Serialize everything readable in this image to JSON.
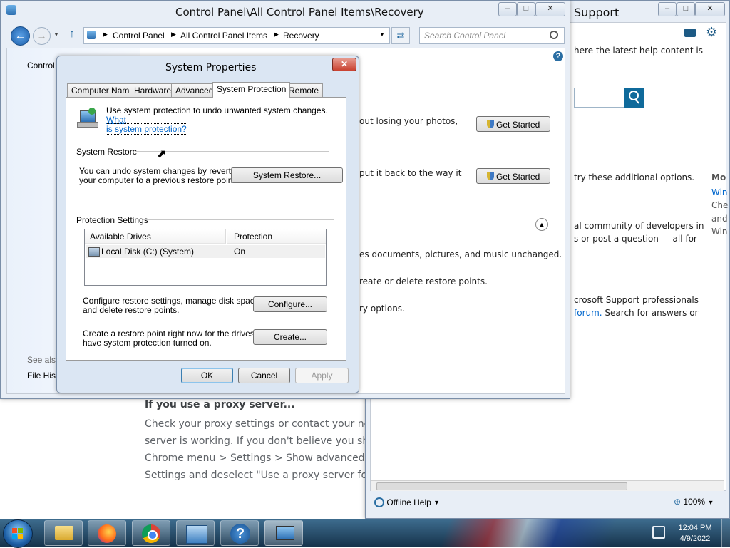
{
  "chrome_page": {
    "heading": "If you use a proxy server...",
    "lines": [
      "Check your proxy settings or contact your netw",
      "server is working. If you don't believe you shou",
      "Chrome menu > Settings > Show advanced se",
      "Settings and deselect \"Use a proxy server for y"
    ]
  },
  "help_window": {
    "title": "Support",
    "intro": "here the latest help content is",
    "options_text": "try these additional options.",
    "community_text_1": "al community of developers in",
    "community_text_2": "s or post a question — all for",
    "support_text_1": "crosoft Support professionals",
    "support_link": "forum.",
    "support_text_2": " Search for answers or",
    "more_heading": "Mo",
    "more_links": [
      "Win",
      "Che",
      "and",
      "Win"
    ],
    "offline_label": "Offline Help",
    "zoom": "100%"
  },
  "control_panel": {
    "title": "Control Panel\\All Control Panel Items\\Recovery",
    "breadcrumb": [
      "Control Panel",
      "All Control Panel Items",
      "Recovery"
    ],
    "search_placeholder": "Search Control Panel",
    "left_item": "Control",
    "see_also": "See also",
    "file_history": "File Hist",
    "row1_text": "out losing your photos,",
    "row2_text": "put it back to the way it",
    "get_started": "Get Started",
    "adv_line1": "es documents, pictures, and music unchanged.",
    "adv_line2": "reate or delete restore points.",
    "adv_line3": "ry options."
  },
  "dialog": {
    "title": "System Properties",
    "tabs": [
      "Computer Name",
      "Hardware",
      "Advanced",
      "System Protection",
      "Remote"
    ],
    "intro_text": "Use system protection to undo unwanted system changes.",
    "intro_link_1": "What",
    "intro_link_2": "is system protection?",
    "system_restore_label": "System Restore",
    "restore_desc_1": "You can undo system changes by reverting",
    "restore_desc_2": "your computer to a previous restore point.",
    "system_restore_button": "System Restore...",
    "protection_settings_label": "Protection Settings",
    "table_headers": [
      "Available Drives",
      "Protection"
    ],
    "drives": [
      {
        "name": "Local Disk (C:) (System)",
        "protection": "On"
      }
    ],
    "configure_desc_1": "Configure restore settings, manage disk space,",
    "configure_desc_2": "and delete restore points.",
    "configure_button": "Configure...",
    "create_desc_1": "Create a restore point right now for the drives that",
    "create_desc_2": "have system protection turned on.",
    "create_button": "Create...",
    "ok": "OK",
    "cancel": "Cancel",
    "apply": "Apply"
  },
  "taskbar": {
    "time": "12:04 PM",
    "date": "4/9/2022",
    "help_glyph": "?"
  },
  "colors": {
    "accent": "#0f6a9b",
    "link": "#0066cc",
    "close_red": "#c9412f"
  }
}
